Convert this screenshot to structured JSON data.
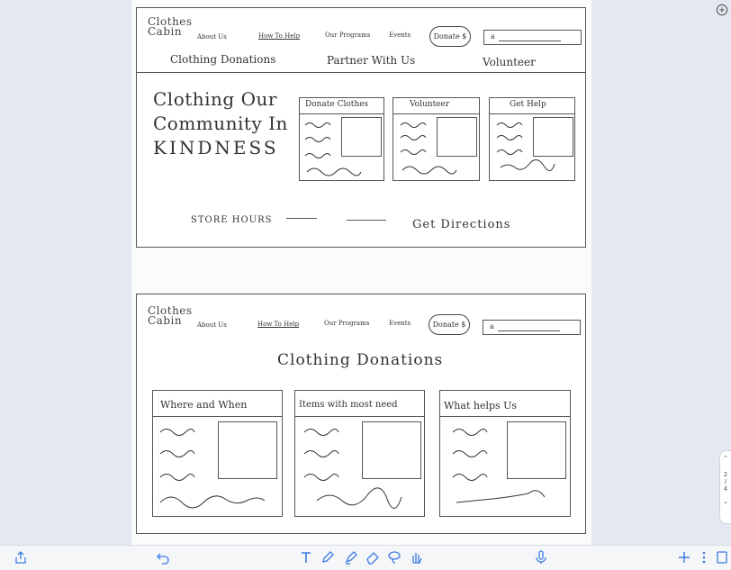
{
  "wireframe1": {
    "logo_line1": "Clothes",
    "logo_line2": "Cabin",
    "nav": [
      "About Us",
      "How To Help",
      "Our Programs",
      "Events"
    ],
    "donate_button": "Donate $",
    "search_glyph": "a",
    "subnav": [
      "Clothing Donations",
      "Partner With Us",
      "Volunteer"
    ],
    "hero_line1": "Clothing Our",
    "hero_line2": "Community In",
    "hero_line3": "KINDNESS",
    "cards": [
      {
        "title": "Donate Clothes"
      },
      {
        "title": "Volunteer"
      },
      {
        "title": "Get Help"
      }
    ],
    "store_hours": "STORE HOURS",
    "get_directions": "Get Directions"
  },
  "wireframe2": {
    "logo_line1": "Clothes",
    "logo_line2": "Cabin",
    "nav": [
      "About Us",
      "How To Help",
      "Our Programs",
      "Events"
    ],
    "donate_button": "Donate $",
    "search_glyph": "a",
    "page_heading": "Clothing Donations",
    "cards": [
      {
        "title": "Where and When"
      },
      {
        "title": "Items with most need"
      },
      {
        "title": "What helps Us"
      }
    ]
  },
  "side_control": {
    "line1": "2",
    "line2": "/",
    "line3": "4"
  },
  "toolbar": {
    "left_icons": [
      "share-icon",
      "undo-icon"
    ],
    "center_icons": [
      "text-tool-icon",
      "pen-icon",
      "highlighter-icon",
      "eraser-icon",
      "lasso-icon",
      "hand-icon"
    ],
    "right_icons": [
      "microphone-icon",
      "add-icon",
      "more-icon",
      "page-icon"
    ]
  },
  "accent_color": "#3b7be0"
}
